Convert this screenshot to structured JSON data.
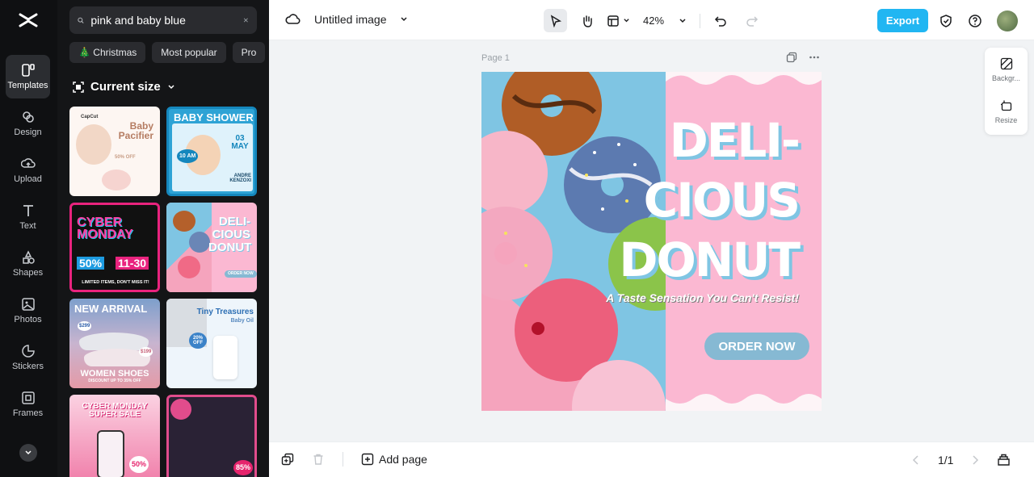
{
  "rail": {
    "items": [
      {
        "label": "Templates"
      },
      {
        "label": "Design"
      },
      {
        "label": "Upload"
      },
      {
        "label": "Text"
      },
      {
        "label": "Shapes"
      },
      {
        "label": "Photos"
      },
      {
        "label": "Stickers"
      },
      {
        "label": "Frames"
      }
    ]
  },
  "panel": {
    "search": {
      "value": "pink and baby blue"
    },
    "chips": [
      "🎄 Christmas",
      "Most popular",
      "Pro"
    ],
    "current_size": "Current size",
    "thumbs": [
      {
        "title": "Baby Pacifier",
        "brand": "CapCut",
        "extra": "50% OFF"
      },
      {
        "title": "BABY SHOWER",
        "date": "03 MAY",
        "time": "10 AM",
        "name": "ANDRE KENZOXI"
      },
      {
        "title": "CYBER MONDAY",
        "discount": "50%",
        "dates": "11-30",
        "footer": "LIMITED ITEMS, DON'T MISS IT!"
      },
      {
        "title": "DELI-CIOUS DONUT",
        "button": "ORDER NOW"
      },
      {
        "title": "NEW ARRIVAL",
        "sub": "WOMEN SHOES",
        "price1": "$299",
        "price2": "$199",
        "footer": "DISCOUNT UP TO 35% OFF"
      },
      {
        "title": "Tiny Treasures",
        "sub": "Baby Oil",
        "badge": "20% OFF"
      },
      {
        "title": "CYBER MONDAY SUPER SALE",
        "badge": "50%"
      },
      {
        "title": "",
        "badge": "85%"
      }
    ]
  },
  "topbar": {
    "title": "Untitled image",
    "zoom": "42%",
    "export": "Export"
  },
  "canvas": {
    "page_label": "Page 1",
    "design": {
      "headline1": "DELI-",
      "headline2": "CIOUS",
      "headline3": "DONUT",
      "tagline": "A Taste Sensation You Can't Resist!",
      "button": "ORDER NOW"
    },
    "right_tools": [
      {
        "label": "Backgr..."
      },
      {
        "label": "Resize"
      }
    ]
  },
  "bottombar": {
    "add_page": "Add page",
    "pages": "1/1"
  },
  "colors": {
    "accent": "#21b6f2",
    "pink": "#fbb8d2",
    "sky": "#7fc5e3",
    "button": "#86b9d3"
  }
}
